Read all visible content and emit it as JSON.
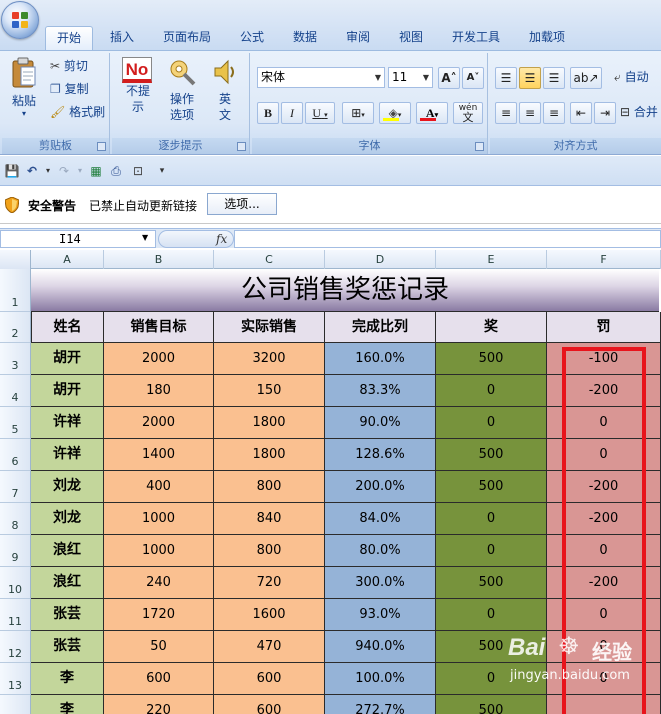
{
  "office_button": {
    "colors": [
      "#e8402a",
      "#3d8a2c",
      "#2f63c6",
      "#f2b418"
    ]
  },
  "tabs": [
    {
      "label": "开始",
      "active": true
    },
    {
      "label": "插入"
    },
    {
      "label": "页面布局"
    },
    {
      "label": "公式"
    },
    {
      "label": "数据"
    },
    {
      "label": "审阅"
    },
    {
      "label": "视图"
    },
    {
      "label": "开发工具"
    },
    {
      "label": "加载项"
    }
  ],
  "ribbon": {
    "clipboard": {
      "label": "剪贴板",
      "paste": "粘贴",
      "cut": "剪切",
      "copy": "复制",
      "format_painter": "格式刷"
    },
    "steps": {
      "label": "逐步提示",
      "no_tip_icon_text": "No",
      "no_tip_line1": "不提",
      "no_tip_line2": "示",
      "options_line1": "操作",
      "options_line2": "选项",
      "english_line1": "英",
      "english_line2": "文"
    },
    "font": {
      "label": "字体",
      "font_name": "宋体",
      "font_size": "11",
      "grow": "A˄",
      "shrink": "A˅",
      "bold": "B",
      "italic": "I",
      "underline": "U",
      "phonetic": "wén",
      "phonetic_char": "文"
    },
    "alignment": {
      "label": "对齐方式",
      "wrap": "自动",
      "merge": "合并"
    }
  },
  "security": {
    "title": "安全警告",
    "message": "已禁止自动更新链接",
    "options_button": "选项..."
  },
  "formula_bar": {
    "name_box": "I14",
    "fx": "fx",
    "value": ""
  },
  "sheet": {
    "columns": [
      "A",
      "B",
      "C",
      "D",
      "E",
      "F"
    ],
    "title": "公司销售奖惩记录",
    "headers": [
      "姓名",
      "销售目标",
      "实际销售",
      "完成比列",
      "奖",
      "罚"
    ],
    "rows": [
      {
        "n": "3",
        "cells": [
          "胡开",
          "2000",
          "3200",
          "160.0%",
          "500",
          "-100"
        ]
      },
      {
        "n": "4",
        "cells": [
          "胡开",
          "180",
          "150",
          "83.3%",
          "0",
          "-200"
        ]
      },
      {
        "n": "5",
        "cells": [
          "许祥",
          "2000",
          "1800",
          "90.0%",
          "0",
          "0"
        ]
      },
      {
        "n": "6",
        "cells": [
          "许祥",
          "1400",
          "1800",
          "128.6%",
          "500",
          "0"
        ]
      },
      {
        "n": "7",
        "cells": [
          "刘龙",
          "400",
          "800",
          "200.0%",
          "500",
          "-200"
        ]
      },
      {
        "n": "8",
        "cells": [
          "刘龙",
          "1000",
          "840",
          "84.0%",
          "0",
          "-200"
        ]
      },
      {
        "n": "9",
        "cells": [
          "浪红",
          "1000",
          "800",
          "80.0%",
          "0",
          "0"
        ]
      },
      {
        "n": "10",
        "cells": [
          "浪红",
          "240",
          "720",
          "300.0%",
          "500",
          "-200"
        ]
      },
      {
        "n": "11",
        "cells": [
          "张芸",
          "1720",
          "1600",
          "93.0%",
          "0",
          "0"
        ]
      },
      {
        "n": "12",
        "cells": [
          "张芸",
          "50",
          "470",
          "940.0%",
          "500",
          "0"
        ]
      },
      {
        "n": "13",
        "cells": [
          "李",
          "600",
          "600",
          "100.0%",
          "0",
          "0"
        ]
      },
      {
        "n": "",
        "cells": [
          "李",
          "220",
          "600",
          "272.7%",
          "500",
          ""
        ]
      }
    ],
    "column_colors": [
      "#c3d69b",
      "#fac090",
      "#fac090",
      "#95b3d7",
      "#77933c",
      "#d99694"
    ],
    "highlight_color": "#e8141c"
  },
  "watermark": {
    "brand": "Bai",
    "brand2": "经验",
    "url": "jingyan.baidu.com"
  }
}
